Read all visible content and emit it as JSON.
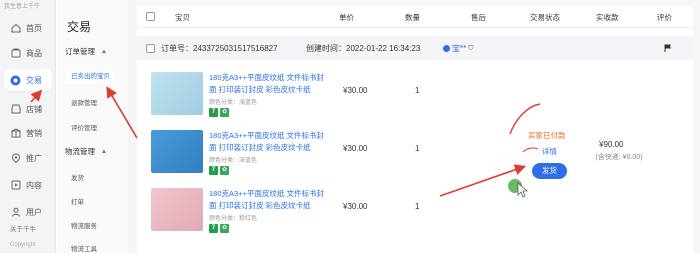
{
  "nav": {
    "brand": "我生意上千牛",
    "items": [
      {
        "label": "首页",
        "icon": "home-icon"
      },
      {
        "label": "商品",
        "icon": "goods-icon"
      },
      {
        "label": "交易",
        "icon": "trade-icon",
        "active": true
      },
      {
        "label": "店铺",
        "icon": "store-icon"
      },
      {
        "label": "营销",
        "icon": "marketing-icon"
      },
      {
        "label": "推广",
        "icon": "promotion-icon"
      },
      {
        "label": "内容",
        "icon": "content-icon"
      },
      {
        "label": "用户",
        "icon": "user-icon"
      }
    ],
    "about": "关于千牛",
    "copyright": "Copyright"
  },
  "submenu": {
    "title": "交易",
    "order_group": "订单管理",
    "order_items": [
      "已卖出的宝贝",
      "退款管理",
      "评价管理"
    ],
    "logistics_group": "物流管理",
    "logistics_items": [
      "发货",
      "打单",
      "物流服务",
      "物流工具"
    ]
  },
  "table": {
    "columns": [
      "宝贝",
      "单价",
      "数量",
      "售后",
      "交易状态",
      "实收款",
      "评价"
    ]
  },
  "order": {
    "number_label": "订单号：",
    "number": "2433725031517516827",
    "created_label": "创建时间：",
    "created": "2022-01-22 16:34:23",
    "buyer": "宝**",
    "status": "买家已付款",
    "detail_link": "详情",
    "ship_button": "发货",
    "total": "¥90.00",
    "freight": "(含快递: ¥0.00)"
  },
  "products": [
    {
      "name": "180克A3++平面皮纹纸 文件标书封面 打印装订封皮 彩色皮纹卡纸",
      "spec": "颜色分类：浅蓝色",
      "price": "¥30.00",
      "qty": "1",
      "color": "#a8d4e6"
    },
    {
      "name": "180克A3++平面皮纹纸 文件标书封面 打印装订封皮 彩色皮纹卡纸",
      "spec": "颜色分类：深蓝色",
      "price": "¥30.00",
      "qty": "1",
      "color": "#3d8fd1"
    },
    {
      "name": "180克A3++平面皮纹纸 文件标书封面 打印装订封皮 彩色皮纹卡纸",
      "spec": "颜色分类：粉红色",
      "price": "¥30.00",
      "qty": "1",
      "color": "#eab6c0"
    }
  ],
  "colors": {
    "accent": "#2a6fe8",
    "status_orange": "#e56b1f",
    "annotation_red": "#e23a2c"
  }
}
